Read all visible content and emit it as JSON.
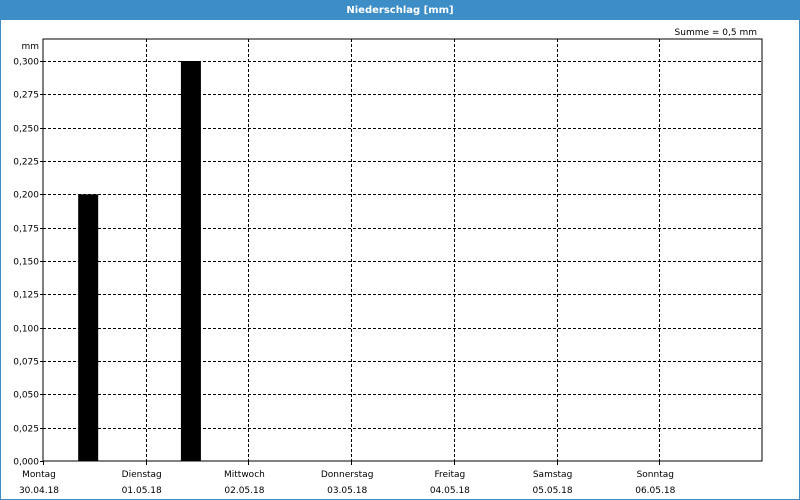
{
  "window": {
    "title": "Niederschlag [mm]"
  },
  "annotation": {
    "sum_text": "Summe = 0,5 mm"
  },
  "chart_data": {
    "type": "bar",
    "title": "Niederschlag [mm]",
    "ylabel": "mm",
    "ylim": [
      0,
      0.3
    ],
    "ytick_step": 0.025,
    "yticks": [
      "0,000",
      "0,025",
      "0,050",
      "0,075",
      "0,100",
      "0,125",
      "0,150",
      "0,175",
      "0,200",
      "0,225",
      "0,250",
      "0,275",
      "0,300"
    ],
    "categories": [
      {
        "day": "Montag",
        "date": "30.04.18"
      },
      {
        "day": "Dienstag",
        "date": "01.05.18"
      },
      {
        "day": "Mittwoch",
        "date": "02.05.18"
      },
      {
        "day": "Donnerstag",
        "date": "03.05.18"
      },
      {
        "day": "Freitag",
        "date": "04.05.18"
      },
      {
        "day": "Samstag",
        "date": "05.05.18"
      },
      {
        "day": "Sonntag",
        "date": "06.05.18"
      }
    ],
    "values": [
      0.2,
      0.3,
      0,
      0,
      0,
      0,
      0
    ],
    "annotations": [
      "Summe = 0,5 mm"
    ],
    "grid": true,
    "legend": "none",
    "colors": {
      "bar": "#000000",
      "grid": "#000000",
      "title_bar": "#3d8ec7",
      "title_text": "#ffffff"
    }
  }
}
